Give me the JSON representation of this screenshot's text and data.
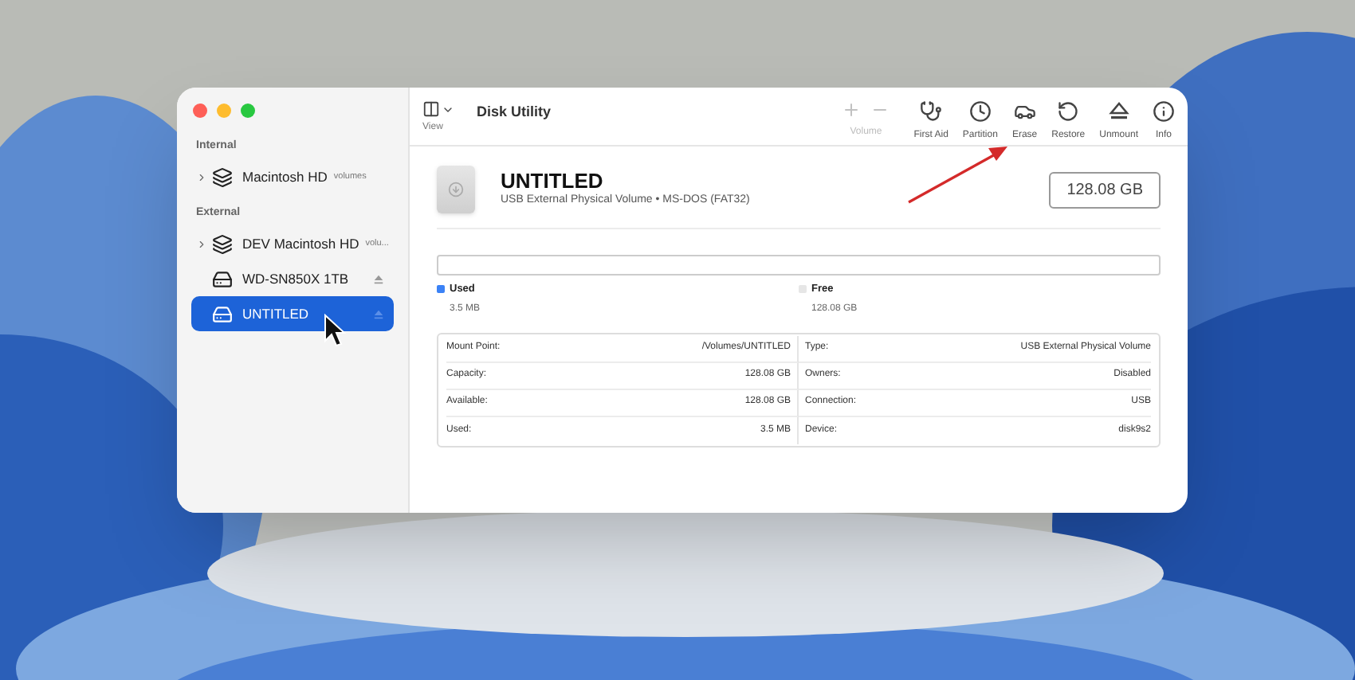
{
  "window": {
    "title": "Disk Utility"
  },
  "sidebar": {
    "sections": [
      {
        "heading": "Internal",
        "items": [
          {
            "label": "Macintosh HD",
            "sublabel": "volumes",
            "kind": "container",
            "expandable": true,
            "ejectable": false,
            "selected": false
          }
        ]
      },
      {
        "heading": "External",
        "items": [
          {
            "label": "DEV Macintosh HD",
            "sublabel": "volu...",
            "kind": "container",
            "expandable": true,
            "ejectable": false,
            "selected": false
          },
          {
            "label": "WD-SN850X 1TB",
            "kind": "drive",
            "expandable": false,
            "ejectable": true,
            "selected": false
          },
          {
            "label": "UNTITLED",
            "kind": "drive",
            "expandable": false,
            "ejectable": true,
            "selected": true
          }
        ]
      }
    ]
  },
  "toolbar": {
    "view_label": "View",
    "buttons": [
      {
        "kind": "volume",
        "label": "Volume",
        "disabled": true
      },
      {
        "kind": "firstaid",
        "label": "First Aid",
        "disabled": false
      },
      {
        "kind": "partition",
        "label": "Partition",
        "disabled": false
      },
      {
        "kind": "erase",
        "label": "Erase",
        "disabled": false
      },
      {
        "kind": "restore",
        "label": "Restore",
        "disabled": false
      },
      {
        "kind": "unmount",
        "label": "Unmount",
        "disabled": false
      },
      {
        "kind": "info",
        "label": "Info",
        "disabled": false
      }
    ]
  },
  "volume": {
    "name": "UNTITLED",
    "description": "USB External Physical Volume • MS-DOS (FAT32)",
    "size": "128.08 GB"
  },
  "usage": {
    "level": 0,
    "legend": [
      {
        "label": "Used",
        "value": "3.5 MB",
        "color": "#3b82f6"
      },
      {
        "label": "Free",
        "value": "128.08 GB",
        "color": "#e6e6e6"
      }
    ]
  },
  "info_table": {
    "rows": [
      {
        "left_label": "Mount Point:",
        "left_value": "/Volumes/UNTITLED",
        "right_label": "Type:",
        "right_value": "USB External Physical Volume"
      },
      {
        "left_label": "Capacity:",
        "left_value": "128.08 GB",
        "right_label": "Owners:",
        "right_value": "Disabled"
      },
      {
        "left_label": "Available:",
        "left_value": "128.08 GB",
        "right_label": "Connection:",
        "right_value": "USB"
      },
      {
        "left_label": "Used:",
        "left_value": "3.5 MB",
        "right_label": "Device:",
        "right_value": "disk9s2"
      }
    ]
  }
}
